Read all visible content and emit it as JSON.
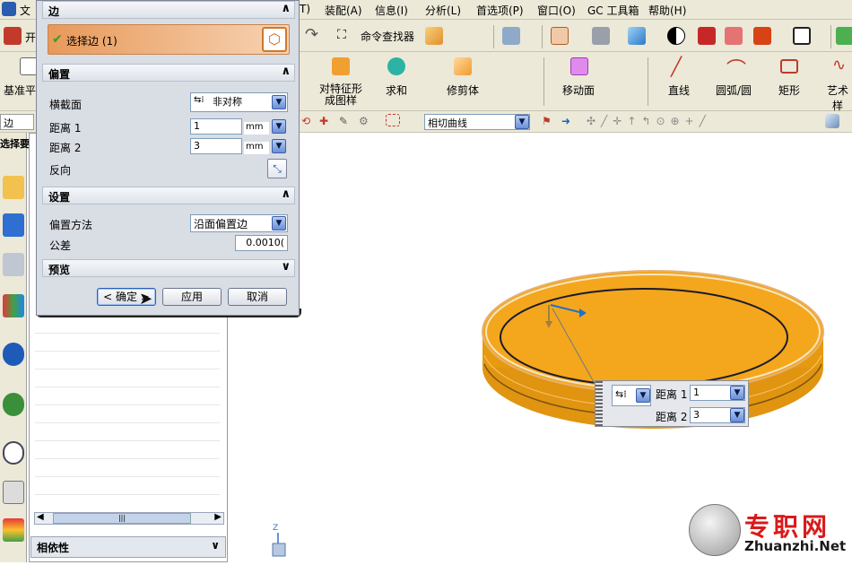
{
  "menubar": {
    "items": [
      "文",
      "T)",
      "装配(A)",
      "信息(I)",
      "分析(L)",
      "首选项(P)",
      "窗口(O)",
      "GC 工具箱",
      "帮助(H)"
    ]
  },
  "toolbar1": {
    "command_finder": "命令查找器",
    "left_label": "开"
  },
  "toolbar2": {
    "datum_plane": "基准平",
    "pattern_feature_l1": "对特征形",
    "pattern_feature_l2": "成图样",
    "unite": "求和",
    "trim_body": "修剪体",
    "move_face": "移动面",
    "line": "直线",
    "arc": "圆弧/圆",
    "rectangle": "矩形",
    "studio_spline": "艺术样"
  },
  "toolbar3": {
    "left_value": "边",
    "curve_rule": "相切曲线"
  },
  "leftpanel": {
    "select_label": "选择要",
    "dependencies": "相依性",
    "scroll_grip": "|||"
  },
  "dialog": {
    "edge_section": "边",
    "select_edge": "选择边 (1)",
    "offset_section": "偏置",
    "cross_section_label": "横截面",
    "cross_section_value": "非对称",
    "distance1_label": "距离 1",
    "distance1_value": "1",
    "distance1_unit": "mm",
    "distance2_label": "距离 2",
    "distance2_value": "3",
    "distance2_unit": "mm",
    "reverse_label": "反向",
    "settings_section": "设置",
    "offset_method_label": "偏置方法",
    "offset_method_value": "沿面偏置边",
    "tolerance_label": "公差",
    "tolerance_value": "0.0010(",
    "preview_section": "预览",
    "ok": "< 确定 >",
    "apply": "应用",
    "cancel": "取消"
  },
  "popup": {
    "distance1_label": "距离 1",
    "distance1_value": "1",
    "distance2_label": "距离 2",
    "distance2_value": "3"
  },
  "axis": {
    "z": "Z"
  },
  "watermark": {
    "brand": "专职网",
    "url": "Zhuanzhi.Net"
  },
  "colors": {
    "disk_top": "#f4a71c",
    "disk_side": "#e69a10",
    "accent_orange": "#e59f52"
  }
}
